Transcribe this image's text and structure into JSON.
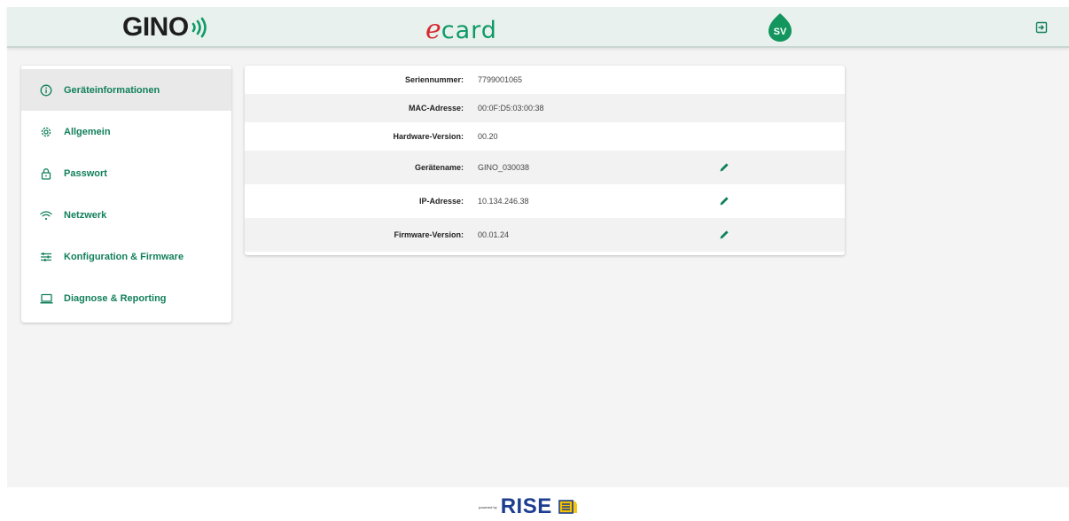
{
  "header": {
    "brand_gino": "GINO",
    "brand_ecard_e": "e",
    "brand_ecard_card": "card",
    "brand_sv": "SV",
    "logout_icon": "logout-icon"
  },
  "sidebar": {
    "items": [
      {
        "label": "Geräteinformationen",
        "icon": "info-icon",
        "active": true
      },
      {
        "label": "Allgemein",
        "icon": "gear-icon",
        "active": false
      },
      {
        "label": "Passwort",
        "icon": "lock-icon",
        "active": false
      },
      {
        "label": "Netzwerk",
        "icon": "wifi-icon",
        "active": false
      },
      {
        "label": "Konfiguration & Firmware",
        "icon": "sliders-icon",
        "active": false
      },
      {
        "label": "Diagnose & Reporting",
        "icon": "laptop-icon",
        "active": false
      }
    ]
  },
  "device_info": {
    "rows": [
      {
        "key": "Seriennummer:",
        "value": "7799001065",
        "editable": false
      },
      {
        "key": "MAC-Adresse:",
        "value": "00:0F:D5:03:00:38",
        "editable": false
      },
      {
        "key": "Hardware-Version:",
        "value": "00.20",
        "editable": false
      },
      {
        "key": "Gerätename:",
        "value": "GINO_030038",
        "editable": true
      },
      {
        "key": "IP-Adresse:",
        "value": "10.134.246.38",
        "editable": true
      },
      {
        "key": "Firmware-Version:",
        "value": "00.01.24",
        "editable": true
      }
    ]
  },
  "footer": {
    "powered_by": "powered by",
    "brand": "RISE"
  },
  "colors": {
    "accent": "#12805a",
    "header_bg": "#e8f1ee",
    "ecard_red": "#d8282f",
    "rise_blue": "#1d3e8f"
  }
}
